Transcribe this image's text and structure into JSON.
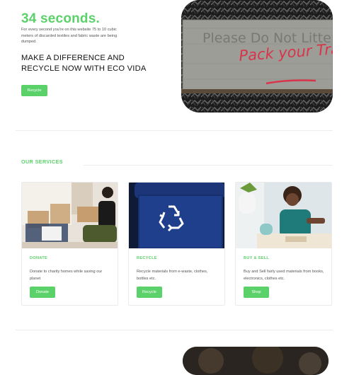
{
  "hero": {
    "title": "34 seconds.",
    "description": "For every second you're on this website 75 to 10 cubic meters of discarded textiles and fabric waste are being dumped.",
    "headline": "MAKE A DIFFERENCE AND RECYCLE NOW WITH ECO VIDA",
    "button_label": "Recycle",
    "image_text": "Pack your Trash!",
    "image_faded_text": "Please Do Not Litter"
  },
  "services": {
    "heading": "OUR SERVICES",
    "cards": [
      {
        "title": "DONATE",
        "description": "Donate to charity homes while saving our planet",
        "button_label": "Donate"
      },
      {
        "title": "RECYCLE",
        "description": "Recycle materials from e-waste, clothes, bottles etc.",
        "button_label": "Recycle"
      },
      {
        "title": "BUY & SELL",
        "description": "Buy and Sell fairly used materials from books, electronics, clothes etc.",
        "button_label": "Shop"
      }
    ]
  },
  "colors": {
    "accent": "#5bd16a",
    "bin_blue": "#1f3f8c",
    "marker_red": "#d8344a"
  }
}
